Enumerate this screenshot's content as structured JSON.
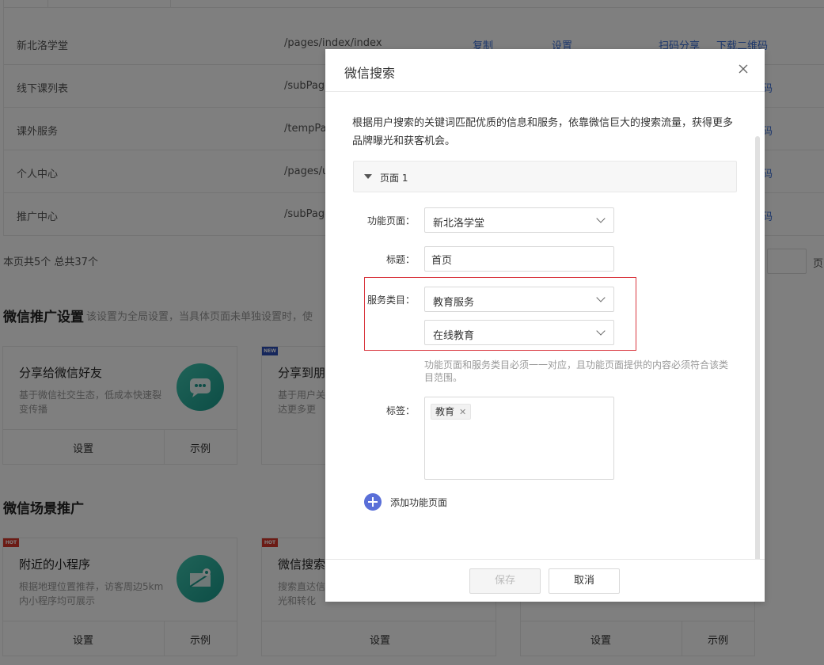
{
  "table": {
    "rows": [
      {
        "name": "新北洛学堂",
        "path": "/pages/index/index",
        "copy": "复制",
        "set": "设置",
        "scan": "扫码分享",
        "download": "下载二维码"
      },
      {
        "name": "线下课列表",
        "path": "/subPage",
        "tail": "码"
      },
      {
        "name": "课外服务",
        "path": "/tempPa",
        "tail": "码"
      },
      {
        "name": "个人中心",
        "path": "/pages/u",
        "tail": "码"
      },
      {
        "name": "推广中心",
        "path": "/subPage",
        "tail": "码"
      }
    ]
  },
  "pager": {
    "summary": "本页共5个 总共37个",
    "page_suffix": "页"
  },
  "promo": {
    "title": "微信推广设置",
    "desc": "该设置为全局设置，当具体页面未单独设置时，使",
    "cards": [
      {
        "title": "分享给微信好友",
        "desc": "基于微信社交生态，低成本快速裂变传播",
        "btn1": "设置",
        "btn2": "示例"
      },
      {
        "title": "分享到朋",
        "desc": "基于用户关触达更多更",
        "badge": "NEW"
      }
    ]
  },
  "scene": {
    "title": "微信场景推广",
    "cards": [
      {
        "title": "附近的小程序",
        "desc": "根据地理位置推荐，访客周边5km内小程序均可展示",
        "btn1": "设置",
        "btn2": "示例",
        "badge": "HOT"
      },
      {
        "title": "微信搜索",
        "desc": "搜索直达信曝光和转化",
        "btn1": "设置",
        "badge": "HOT"
      },
      {
        "btn1": "设置",
        "btn2": "示例"
      }
    ]
  },
  "dialog": {
    "title": "微信搜索",
    "intro": "根据用户搜索的关键词匹配优质的信息和服务，依靠微信巨大的搜索流量，获得更多品牌曝光和获客机会。",
    "section": "页面 1",
    "page_label": "功能页面：",
    "page_value": "新北洛学堂",
    "title_label": "标题：",
    "title_value": "首页",
    "service_label": "服务类目：",
    "service_value1": "教育服务",
    "service_value2": "在线教育",
    "hint": "功能页面和服务类目必须一一对应，且功能页面提供的内容必须符合该类目范围。",
    "tag_label": "标签：",
    "tags": [
      "教育"
    ],
    "add_label": "添加功能页面",
    "save": "保存",
    "cancel": "取消"
  },
  "colors": {
    "accent": "#5a6fd8",
    "link": "#3a6fd8",
    "highlight_border": "#d9363e",
    "icon_teal": "#1a9b8c"
  }
}
